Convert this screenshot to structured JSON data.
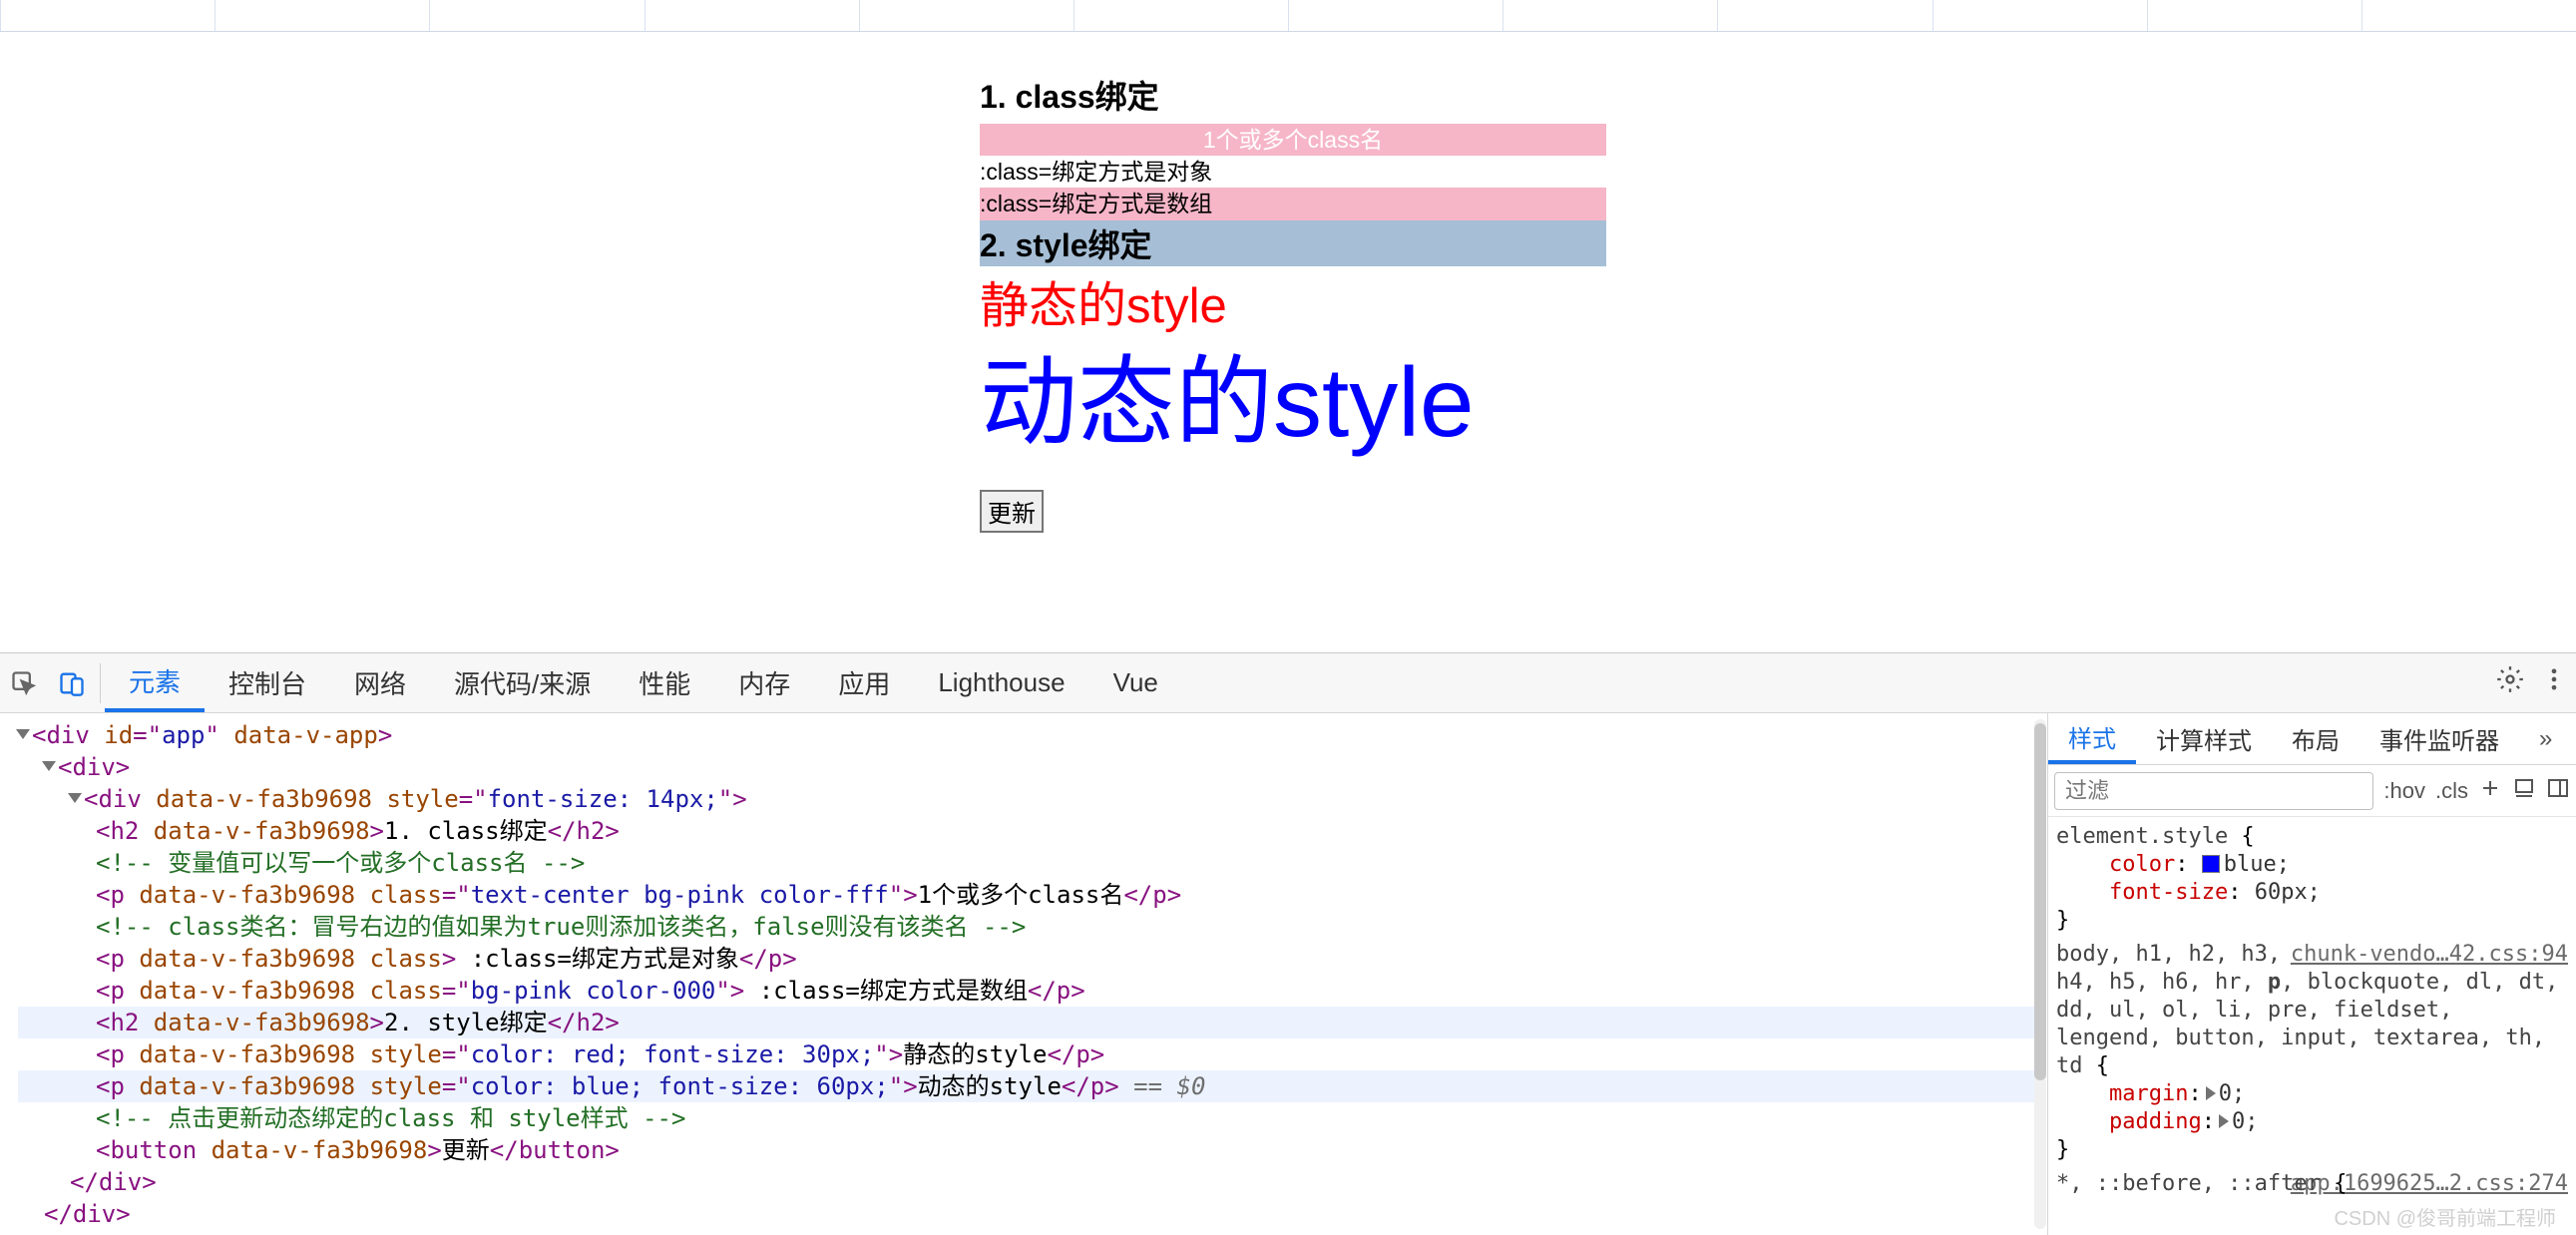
{
  "page": {
    "h1": "1. class绑定",
    "p_centered": "1个或多个class名",
    "p_obj": ":class=绑定方式是对象",
    "p_arr": ":class=绑定方式是数组",
    "h2": "2. style绑定",
    "p_static": "静态的style",
    "p_dynamic": "动态的style",
    "btn": "更新"
  },
  "devtools": {
    "tabs": [
      "元素",
      "控制台",
      "网络",
      "源代码/来源",
      "性能",
      "内存",
      "应用",
      "Lighthouse",
      "Vue"
    ]
  },
  "dom_lines": [
    {
      "indent": 0,
      "tri": true,
      "seg": [
        [
          "tag",
          "<div "
        ],
        [
          "an",
          "id"
        ],
        [
          "tag",
          "=\""
        ],
        [
          "av",
          "app"
        ],
        [
          "tag",
          "\" "
        ],
        [
          "an",
          "data-v-app"
        ],
        [
          "tag",
          ">"
        ]
      ]
    },
    {
      "indent": 1,
      "tri": true,
      "seg": [
        [
          "tag",
          "<div>"
        ]
      ]
    },
    {
      "indent": 2,
      "tri": true,
      "seg": [
        [
          "tag",
          "<div "
        ],
        [
          "an",
          "data-v-fa3b9698"
        ],
        [
          "tag",
          " "
        ],
        [
          "an",
          "style"
        ],
        [
          "tag",
          "=\""
        ],
        [
          "av",
          "font-size: 14px;"
        ],
        [
          "tag",
          "\">"
        ]
      ]
    },
    {
      "indent": 3,
      "seg": [
        [
          "tag",
          "<h2 "
        ],
        [
          "an",
          "data-v-fa3b9698"
        ],
        [
          "tag",
          ">"
        ],
        [
          "text",
          "1. class绑定"
        ],
        [
          "tag",
          "</h2>"
        ]
      ]
    },
    {
      "indent": 3,
      "seg": [
        [
          "comment",
          "<!-- 变量值可以写一个或多个class名 -->"
        ]
      ]
    },
    {
      "indent": 3,
      "seg": [
        [
          "tag",
          "<p "
        ],
        [
          "an",
          "data-v-fa3b9698"
        ],
        [
          "tag",
          " "
        ],
        [
          "an",
          "class"
        ],
        [
          "tag",
          "=\""
        ],
        [
          "av",
          "text-center bg-pink color-fff"
        ],
        [
          "tag",
          "\">"
        ],
        [
          "text",
          "1个或多个class名"
        ],
        [
          "tag",
          "</p>"
        ]
      ]
    },
    {
      "indent": 3,
      "seg": [
        [
          "comment",
          "<!-- class类名：冒号右边的值如果为true则添加该类名，false则没有该类名 -->"
        ]
      ]
    },
    {
      "indent": 3,
      "seg": [
        [
          "tag",
          "<p "
        ],
        [
          "an",
          "data-v-fa3b9698"
        ],
        [
          "tag",
          " "
        ],
        [
          "an",
          "class"
        ],
        [
          "tag",
          "> "
        ],
        [
          "text",
          ":class=绑定方式是对象"
        ],
        [
          "tag",
          "</p>"
        ]
      ]
    },
    {
      "indent": 3,
      "seg": [
        [
          "tag",
          "<p "
        ],
        [
          "an",
          "data-v-fa3b9698"
        ],
        [
          "tag",
          " "
        ],
        [
          "an",
          "class"
        ],
        [
          "tag",
          "=\""
        ],
        [
          "av",
          "bg-pink color-000"
        ],
        [
          "tag",
          "\"> "
        ],
        [
          "text",
          ":class=绑定方式是数组"
        ],
        [
          "tag",
          "</p>"
        ]
      ]
    },
    {
      "indent": 3,
      "hl": true,
      "seg": [
        [
          "tag",
          "<h2 "
        ],
        [
          "an",
          "data-v-fa3b9698"
        ],
        [
          "tag",
          ">"
        ],
        [
          "text",
          "2. style绑定"
        ],
        [
          "tag",
          "</h2>"
        ]
      ]
    },
    {
      "indent": 3,
      "seg": [
        [
          "tag",
          "<p "
        ],
        [
          "an",
          "data-v-fa3b9698"
        ],
        [
          "tag",
          " "
        ],
        [
          "an",
          "style"
        ],
        [
          "tag",
          "=\""
        ],
        [
          "av",
          "color: red; font-size: 30px;"
        ],
        [
          "tag",
          "\">"
        ],
        [
          "text",
          "静态的style"
        ],
        [
          "tag",
          "</p>"
        ]
      ]
    },
    {
      "indent": 3,
      "hl": true,
      "seg": [
        [
          "tag",
          "<p "
        ],
        [
          "an",
          "data-v-fa3b9698"
        ],
        [
          "tag",
          " "
        ],
        [
          "an",
          "style"
        ],
        [
          "tag",
          "=\""
        ],
        [
          "av",
          "color: blue; font-size: 60px;"
        ],
        [
          "tag",
          "\">"
        ],
        [
          "text",
          "动态的style"
        ],
        [
          "tag",
          "</p>"
        ],
        [
          "sel",
          " == $0"
        ]
      ]
    },
    {
      "indent": 3,
      "seg": [
        [
          "comment",
          "<!-- 点击更新动态绑定的class 和 style样式 -->"
        ]
      ]
    },
    {
      "indent": 3,
      "seg": [
        [
          "tag",
          "<button "
        ],
        [
          "an",
          "data-v-fa3b9698"
        ],
        [
          "tag",
          ">"
        ],
        [
          "text",
          "更新"
        ],
        [
          "tag",
          "</button>"
        ]
      ]
    },
    {
      "indent": 2,
      "seg": [
        [
          "tag",
          "</div>"
        ]
      ]
    },
    {
      "indent": 1,
      "seg": [
        [
          "tag",
          "</div>"
        ]
      ]
    }
  ],
  "styles": {
    "side_tabs": [
      "样式",
      "计算样式",
      "布局",
      "事件监听器"
    ],
    "filter_placeholder": "过滤",
    "hov": ":hov",
    "cls": ".cls",
    "element_style": {
      "selector": "element.style",
      "decls": [
        {
          "prop": "color",
          "val": "blue",
          "swatch": "#0000ff"
        },
        {
          "prop": "font-size",
          "val": "60px"
        }
      ]
    },
    "rule2": {
      "selectors": "body, h1, h2, h3, h4, h5, h6, hr, p, blockquote, dl, dt, dd, ul, ol, li, pre, fieldset, lengend, button, input, textarea, th, td",
      "bold_selector": "p",
      "source": "chunk-vendo…42.css:94",
      "decls": [
        {
          "prop": "margin",
          "val": "0",
          "tri": true
        },
        {
          "prop": "padding",
          "val": "0",
          "tri": true
        }
      ]
    },
    "rule3": {
      "selectors": "*, ::before, ::after",
      "source": "app.1699625…2.css:274"
    }
  },
  "watermark": "CSDN @俊哥前端工程师"
}
